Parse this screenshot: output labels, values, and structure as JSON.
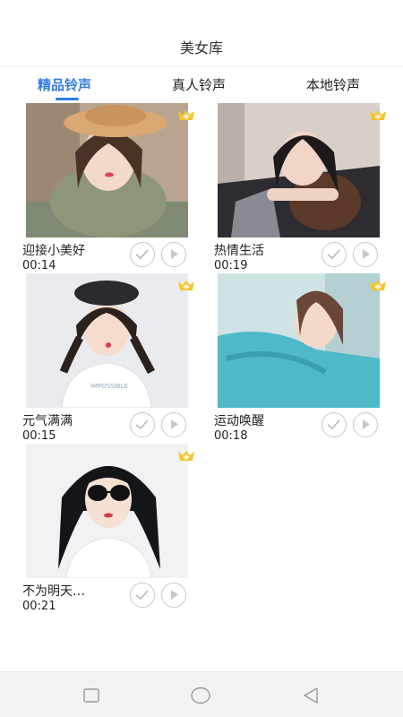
{
  "header": {
    "title": "美女库"
  },
  "tabs": [
    {
      "label": "精品铃声",
      "active": true
    },
    {
      "label": "真人铃声",
      "active": false
    },
    {
      "label": "本地铃声",
      "active": false
    }
  ],
  "ringtones": [
    {
      "name": "迎接小美好",
      "duration": "00:14"
    },
    {
      "name": "热情生活",
      "duration": "00:19"
    },
    {
      "name": "元气满满",
      "duration": "00:15"
    },
    {
      "name": "运动唤醒",
      "duration": "00:18"
    },
    {
      "name": "不为明天…",
      "duration": "00:21"
    }
  ],
  "colors": {
    "accent": "#2f7de1",
    "vip_badge": "#f4c430",
    "icon_gray": "#c8c8c8"
  },
  "icons": {
    "vip": "crown-badge-icon",
    "check": "check-circle-icon",
    "play": "play-circle-icon",
    "nav": [
      "square-recent-apps-icon",
      "circle-home-icon",
      "triangle-back-icon"
    ]
  }
}
